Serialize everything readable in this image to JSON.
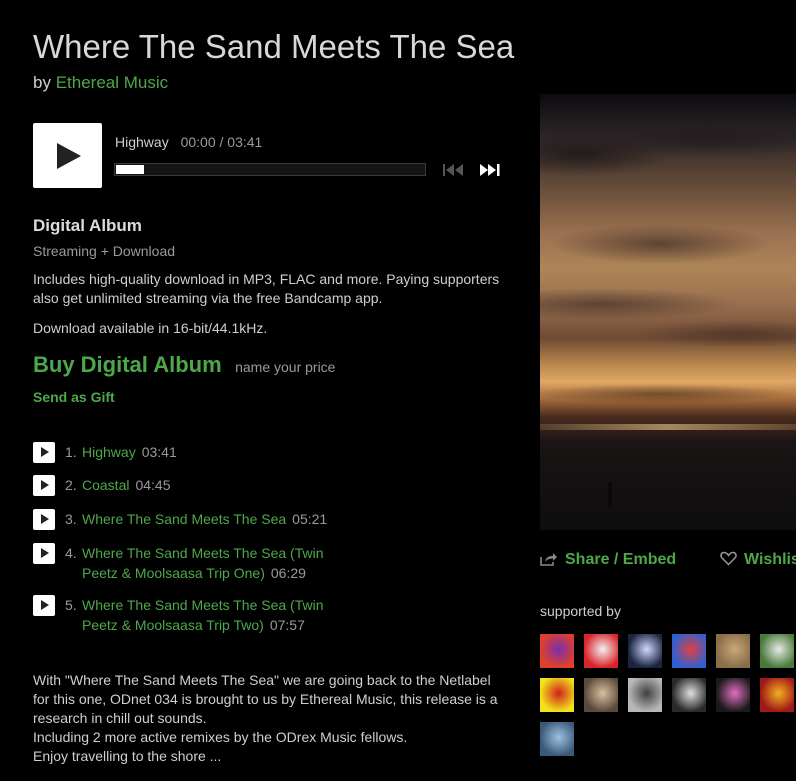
{
  "album": {
    "title": "Where The Sand Meets The Sea",
    "by_prefix": "by",
    "artist": "Ethereal Music"
  },
  "player": {
    "track_title": "Highway",
    "time": "00:00 / 03:41",
    "progress": 0.0,
    "play_icon": "play-icon",
    "prev_icon": "skip-previous-icon",
    "next_icon": "skip-next-icon"
  },
  "purchase": {
    "format_title": "Digital Album",
    "format_subtitle": "Streaming + Download",
    "description": "Includes high-quality download in MP3, FLAC and more. Paying supporters also get unlimited streaming via the free Bandcamp app.",
    "download_note": "Download available in 16-bit/44.1kHz.",
    "buy_label": "Buy Digital Album",
    "price_note": "name your price",
    "gift_label": "Send as Gift"
  },
  "tracks": [
    {
      "num": "1.",
      "title": "Highway",
      "duration": "03:41"
    },
    {
      "num": "2.",
      "title": "Coastal",
      "duration": "04:45"
    },
    {
      "num": "3.",
      "title": "Where The Sand Meets The Sea",
      "duration": "05:21"
    },
    {
      "num": "4.",
      "title": "Where The Sand Meets The Sea (Twin Peetz & Moolsaasa Trip One)",
      "duration": "06:29"
    },
    {
      "num": "5.",
      "title": "Where The Sand Meets The Sea (Twin Peetz & Moolsaasa Trip Two)",
      "duration": "07:57"
    }
  ],
  "about": {
    "lines": [
      "With \"Where The Sand Meets The Sea\" we are going back to the Netlabel for this one, ODnet 034 is brought to us by Ethereal Music, this release is a research in chill out sounds.",
      "Including 2 more active remixes by the ODrex Music fellows.",
      "Enjoy travelling to the shore ..."
    ]
  },
  "sidebar": {
    "share_label": "Share / Embed",
    "wishlist_label": "Wishlist",
    "supported_label": "supported by",
    "fan_avatars": [
      {
        "icon": "fan-avatar",
        "colors": [
          "#e0402a",
          "#7a2fb0"
        ]
      },
      {
        "icon": "fan-avatar",
        "colors": [
          "#d8242a",
          "#f2f2f2"
        ]
      },
      {
        "icon": "fan-avatar",
        "colors": [
          "#1c2440",
          "#cfd8ff"
        ]
      },
      {
        "icon": "fan-avatar",
        "colors": [
          "#3060d0",
          "#e04040"
        ]
      },
      {
        "icon": "fan-avatar",
        "colors": [
          "#8a6e4a",
          "#c9a878"
        ]
      },
      {
        "icon": "fan-avatar",
        "colors": [
          "#4a7a3a",
          "#e8e8e8"
        ]
      },
      {
        "icon": "fan-avatar",
        "colors": [
          "#f2e21a",
          "#d02020"
        ]
      },
      {
        "icon": "fan-avatar",
        "colors": [
          "#5a4a3a",
          "#d8c0a0"
        ]
      },
      {
        "icon": "fan-avatar",
        "colors": [
          "#b8b8b8",
          "#404040"
        ]
      },
      {
        "icon": "fan-avatar",
        "colors": [
          "#2a2a2a",
          "#e0e0e0"
        ]
      },
      {
        "icon": "fan-avatar",
        "colors": [
          "#1a1a1a",
          "#e070c0"
        ]
      },
      {
        "icon": "fan-avatar",
        "colors": [
          "#a01818",
          "#f0b020"
        ]
      },
      {
        "icon": "fan-avatar",
        "colors": [
          "#3a5a7a",
          "#a0c0e0"
        ]
      }
    ]
  }
}
